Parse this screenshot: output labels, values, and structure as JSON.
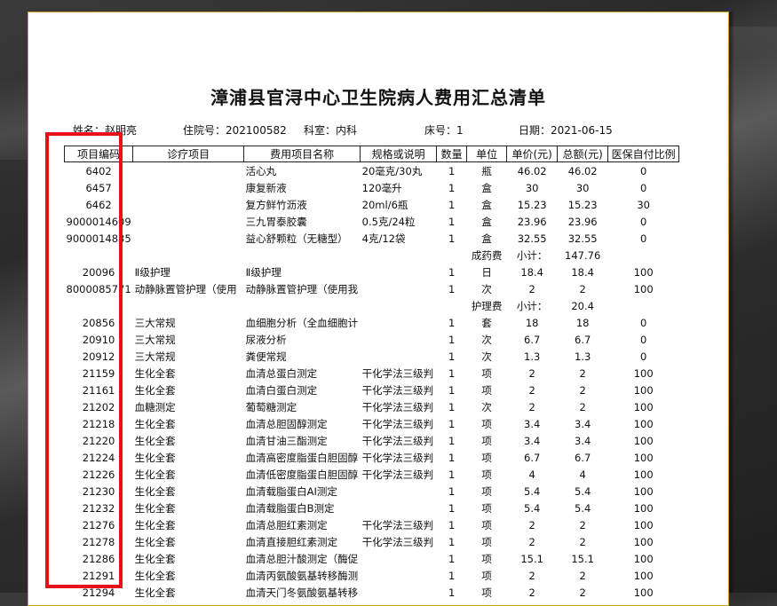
{
  "title": "漳浦县官浔中心卫生院病人费用汇总清单",
  "patient": {
    "name_label": "姓名：",
    "name": "赵明亮",
    "admission_label": "住院号：",
    "admission_no": "202100582",
    "dept_label": "科室：",
    "dept": "内科",
    "bed_label": "床号：",
    "bed": "1",
    "date_label": "日期：",
    "date": "2021-06-15"
  },
  "table": {
    "headers": [
      "项目编码",
      "诊疗项目",
      "费用项目名称",
      "规格或说明",
      "数量",
      "单位",
      "单价(元)",
      "总额(元)",
      "医保自付比例"
    ],
    "rows": [
      [
        "6402",
        "",
        "活心丸",
        "20毫克/30丸",
        "1",
        "瓶",
        "46.02",
        "46.02",
        "0"
      ],
      [
        "6457",
        "",
        "康复新液",
        "120毫升",
        "1",
        "盒",
        "30",
        "30",
        "0"
      ],
      [
        "6462",
        "",
        "复方鲜竹沥液",
        "20ml/6瓶",
        "1",
        "盒",
        "15.23",
        "15.23",
        "30"
      ],
      [
        "9000014609",
        "",
        "三九胃泰胶囊",
        "0.5克/24粒",
        "1",
        "盒",
        "23.96",
        "23.96",
        "0"
      ],
      [
        "9000014835",
        "",
        "益心舒颗粒（无糖型）",
        "4克/12袋",
        "1",
        "盒",
        "32.55",
        "32.55",
        "0"
      ],
      [
        "",
        "",
        "",
        "",
        "",
        "成药费",
        "小计：",
        "147.76",
        ""
      ],
      [
        "20096",
        "Ⅱ级护理",
        "Ⅱ级护理",
        "",
        "1",
        "日",
        "18.4",
        "18.4",
        "100"
      ],
      [
        "8000085771",
        "动静脉置管护理（使用",
        "动静脉置管护理（使用我",
        "",
        "1",
        "次",
        "2",
        "2",
        "100"
      ],
      [
        "",
        "",
        "",
        "",
        "",
        "护理费",
        "小计：",
        "20.4",
        ""
      ],
      [
        "20856",
        "三大常规",
        "血细胞分析（全血细胞计",
        "",
        "1",
        "套",
        "18",
        "18",
        "0"
      ],
      [
        "20910",
        "三大常规",
        "尿液分析",
        "",
        "1",
        "次",
        "6.7",
        "6.7",
        "0"
      ],
      [
        "20912",
        "三大常规",
        "粪便常规",
        "",
        "1",
        "次",
        "1.3",
        "1.3",
        "0"
      ],
      [
        "21159",
        "生化全套",
        "血清总蛋白测定",
        "干化学法三级判",
        "1",
        "项",
        "2",
        "2",
        "100"
      ],
      [
        "21161",
        "生化全套",
        "血清白蛋白测定",
        "干化学法三级判",
        "1",
        "项",
        "2",
        "2",
        "100"
      ],
      [
        "21202",
        "血糖测定",
        "葡萄糖测定",
        "干化学法三级判",
        "1",
        "次",
        "2",
        "2",
        "100"
      ],
      [
        "21218",
        "生化全套",
        "血清总胆固醇测定",
        "干化学法三级判",
        "1",
        "项",
        "3.4",
        "3.4",
        "100"
      ],
      [
        "21220",
        "生化全套",
        "血清甘油三酯测定",
        "干化学法三级判",
        "1",
        "项",
        "3.4",
        "3.4",
        "100"
      ],
      [
        "21224",
        "生化全套",
        "血清高密度脂蛋白胆固醇",
        "干化学法三级判",
        "1",
        "项",
        "6.7",
        "6.7",
        "100"
      ],
      [
        "21226",
        "生化全套",
        "血清低密度脂蛋白胆固醇",
        "干化学法三级判",
        "1",
        "项",
        "4",
        "4",
        "100"
      ],
      [
        "21230",
        "生化全套",
        "血清载脂蛋白AⅠ测定",
        "",
        "1",
        "项",
        "5.4",
        "5.4",
        "100"
      ],
      [
        "21232",
        "生化全套",
        "血清载脂蛋白B测定",
        "",
        "1",
        "项",
        "5.4",
        "5.4",
        "100"
      ],
      [
        "21276",
        "生化全套",
        "血清总胆红素测定",
        "干化学法三级判",
        "1",
        "项",
        "2",
        "2",
        "100"
      ],
      [
        "21278",
        "生化全套",
        "血清直接胆红素测定",
        "干化学法三级判",
        "1",
        "项",
        "2",
        "2",
        "100"
      ],
      [
        "21286",
        "生化全套",
        "血清总胆汁酸测定（酶促",
        "",
        "1",
        "项",
        "15.1",
        "15.1",
        "100"
      ],
      [
        "21291",
        "生化全套",
        "血清丙氨酸氨基转移酶测",
        "",
        "1",
        "项",
        "2",
        "2",
        "100"
      ],
      [
        "21294",
        "生化全套",
        "血清天门冬氨酸氨基转移",
        "",
        "1",
        "项",
        "2",
        "2",
        "100"
      ]
    ]
  },
  "colors": {
    "highlight": "#e8101a",
    "paper_border": "#c9a227"
  }
}
